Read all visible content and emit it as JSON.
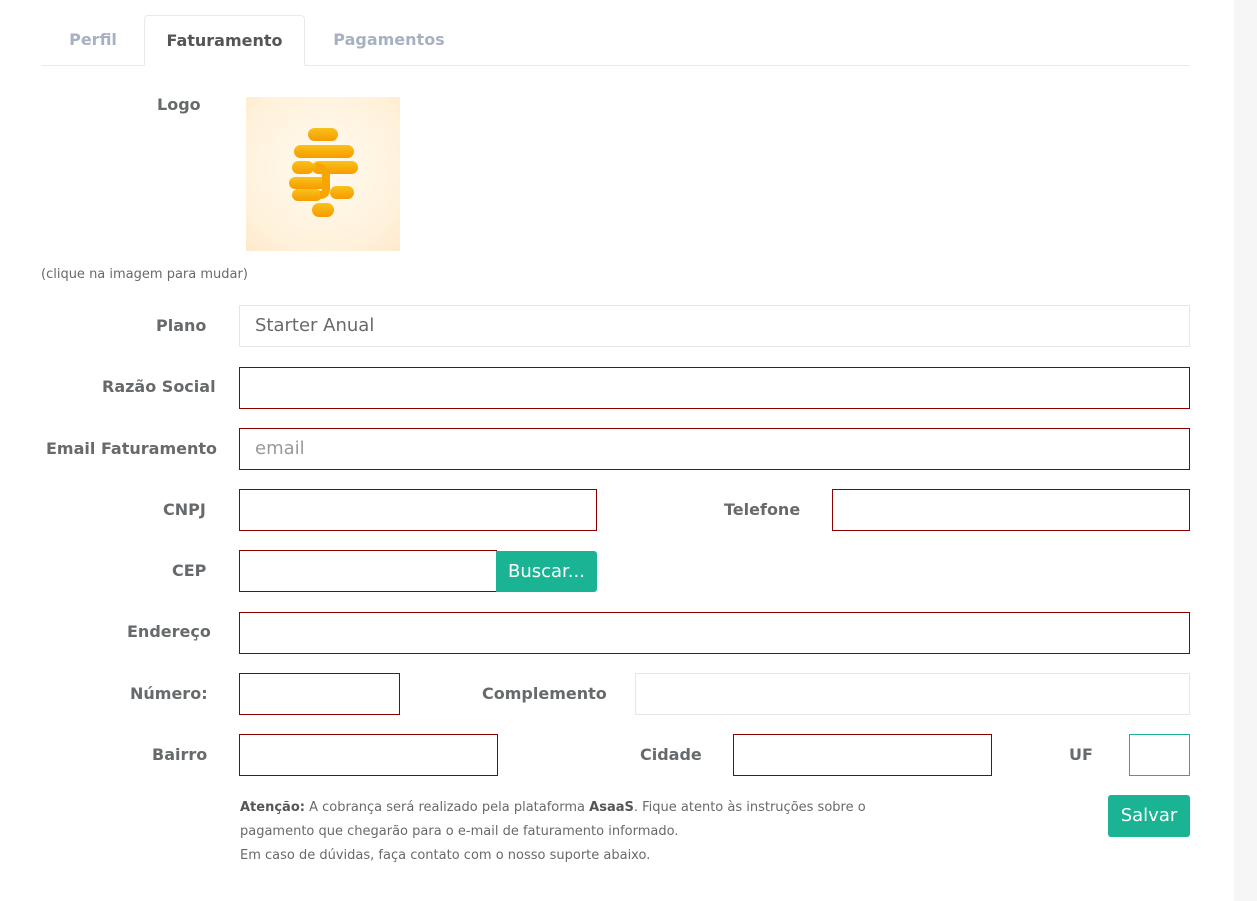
{
  "tabs": [
    {
      "label": "Perfil",
      "active": false
    },
    {
      "label": "Faturamento",
      "active": true
    },
    {
      "label": "Pagamentos",
      "active": false
    }
  ],
  "logo": {
    "label": "Logo",
    "hint": "(clique na imagem para mudar)",
    "icon": "brand-logo-icon",
    "colors": {
      "gold": "#f6b90a",
      "orange": "#f7a000",
      "background": "#fff4e2"
    }
  },
  "form": {
    "plano": {
      "label": "Plano",
      "value": "Starter Anual"
    },
    "razao_social": {
      "label": "Razão Social",
      "value": ""
    },
    "email": {
      "label": "Email Faturamento",
      "value": "",
      "placeholder": "email"
    },
    "cnpj": {
      "label": "CNPJ",
      "value": ""
    },
    "telefone": {
      "label": "Telefone",
      "value": ""
    },
    "cep": {
      "label": "CEP",
      "value": "",
      "button": "Buscar..."
    },
    "endereco": {
      "label": "Endereço",
      "value": ""
    },
    "numero": {
      "label": "Número:",
      "value": ""
    },
    "complemento": {
      "label": "Complemento",
      "value": ""
    },
    "bairro": {
      "label": "Bairro",
      "value": ""
    },
    "cidade": {
      "label": "Cidade",
      "value": ""
    },
    "uf": {
      "label": "UF",
      "value": ""
    }
  },
  "notice": {
    "lead": "Atenção:",
    "text1": " A cobrança será realizado pela plataforma ",
    "platform": "AsaaS",
    "text2": ". Fique atento às instruções sobre o pagamento que chegarão para o e-mail de faturamento informado.",
    "line2": "Em caso de dúvidas, faça contato com o nosso suporte abaixo."
  },
  "actions": {
    "save_label": "Salvar"
  },
  "colors": {
    "primary": "#1ab394",
    "invalid_border": "#8b0000"
  }
}
